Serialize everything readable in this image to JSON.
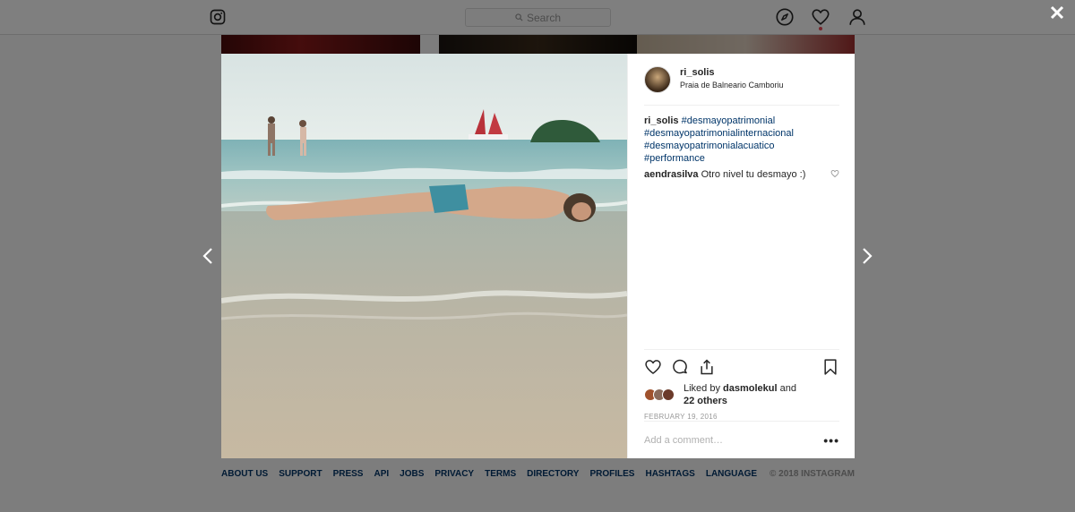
{
  "header": {
    "logo_icon": "instagram-camera-icon",
    "search_placeholder": "Search",
    "nav_icons": [
      "compass-icon",
      "heart-icon",
      "person-icon"
    ],
    "activity_dot_color": "#ed4956"
  },
  "footer": {
    "links": [
      "ABOUT US",
      "SUPPORT",
      "PRESS",
      "API",
      "JOBS",
      "PRIVACY",
      "TERMS",
      "DIRECTORY",
      "PROFILES",
      "HASHTAGS",
      "LANGUAGE"
    ],
    "copyright": "© 2018 INSTAGRAM"
  },
  "modal": {
    "close_icon": "close-icon",
    "prev_icon": "chevron-left-icon",
    "next_icon": "chevron-right-icon",
    "post": {
      "username": "ri_solis",
      "location": "Praia de Balneario Camboriu",
      "caption": {
        "user": "ri_solis",
        "hashtags": [
          "#desmayopatrimonial",
          "#desmayopatrimonialinternacional",
          "#desmayopatrimonialacuatico",
          "#performance"
        ]
      },
      "comments": [
        {
          "user": "aendrasilva",
          "text": "Otro nivel tu desmayo :)"
        }
      ],
      "likes": {
        "prefix": "Liked by ",
        "user": "dasmolekul",
        "middle": " and",
        "others": "22 others"
      },
      "date": "FEBRUARY 19, 2016",
      "comment_placeholder": "Add a comment…",
      "more_label": "•••"
    }
  },
  "colors": {
    "link": "#003569",
    "muted": "#999999",
    "border": "#dbdbdb"
  }
}
